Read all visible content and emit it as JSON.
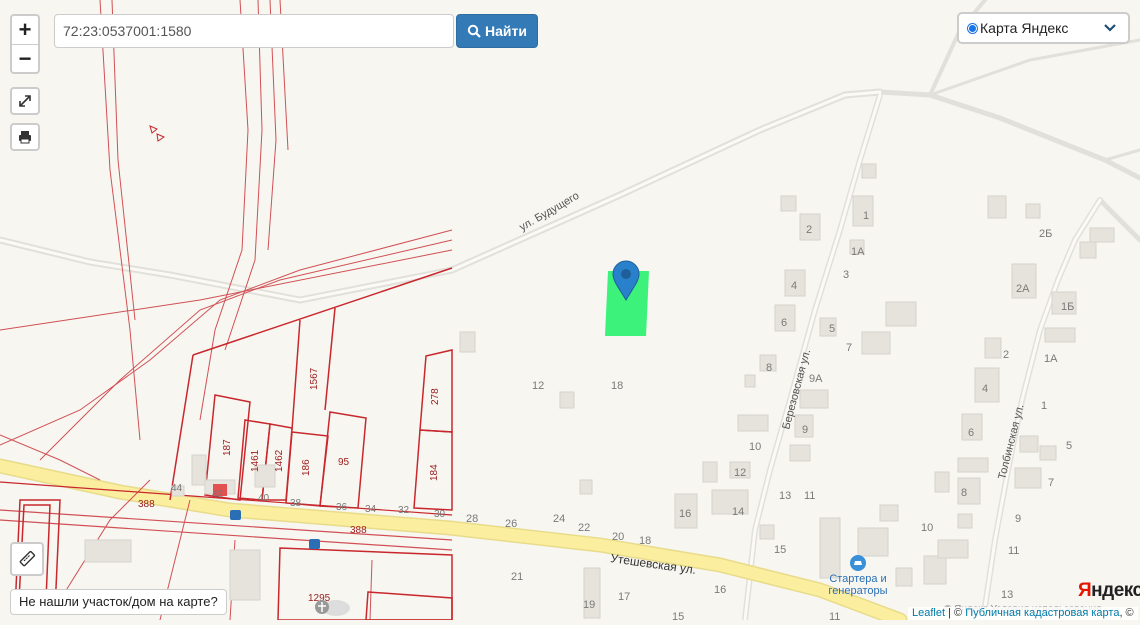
{
  "search": {
    "value": "72:23:0537001:1580",
    "button_label": "Найти"
  },
  "zoom": {
    "in_label": "+",
    "out_label": "−"
  },
  "layer": {
    "selected": "Карта Яндекс"
  },
  "help_button": "Не нашли участок/дом на карте?",
  "attribution": {
    "leaflet": "Leaflet",
    "separator": "| ©",
    "cadastre": "Публичная кадастровая карта",
    "suffix": ", ©"
  },
  "yandex": {
    "logo_first": "Я",
    "logo_rest": "ндекс",
    "copyright": "© Яндекс Условия использования"
  },
  "streets": [
    {
      "name": "ул. Будущего"
    },
    {
      "name": "Березовская ул."
    },
    {
      "name": "Толбинская ул."
    },
    {
      "name": "Утешевская ул."
    }
  ],
  "poi": {
    "line1": "Стартера и",
    "line2": "генераторы"
  },
  "house_numbers": [
    "1",
    "2",
    "1А",
    "3",
    "4",
    "6",
    "5",
    "7",
    "8",
    "9А",
    "9",
    "10",
    "12",
    "13",
    "11",
    "14",
    "16",
    "15",
    "2Б",
    "2А",
    "1Б",
    "1А",
    "2",
    "4",
    "1",
    "6",
    "5",
    "8",
    "7",
    "9",
    "10",
    "11",
    "13",
    "12",
    "18",
    "28",
    "26",
    "24",
    "22",
    "20",
    "18",
    "21",
    "19",
    "17",
    "16",
    "11",
    "15"
  ],
  "cadastre_labels": [
    "187",
    "1461",
    "1462",
    "186",
    "95",
    "1567",
    "278",
    "184",
    "388",
    "388",
    "1295"
  ],
  "cadastre_small_numbers": [
    "44",
    "42",
    "40",
    "38",
    "36",
    "34",
    "32",
    "30"
  ],
  "colors": {
    "parcel_highlight": "#3cf27b",
    "marker": "#2a81cb",
    "cadastre_line": "#c8282d",
    "main_road": "#fbef9f"
  }
}
